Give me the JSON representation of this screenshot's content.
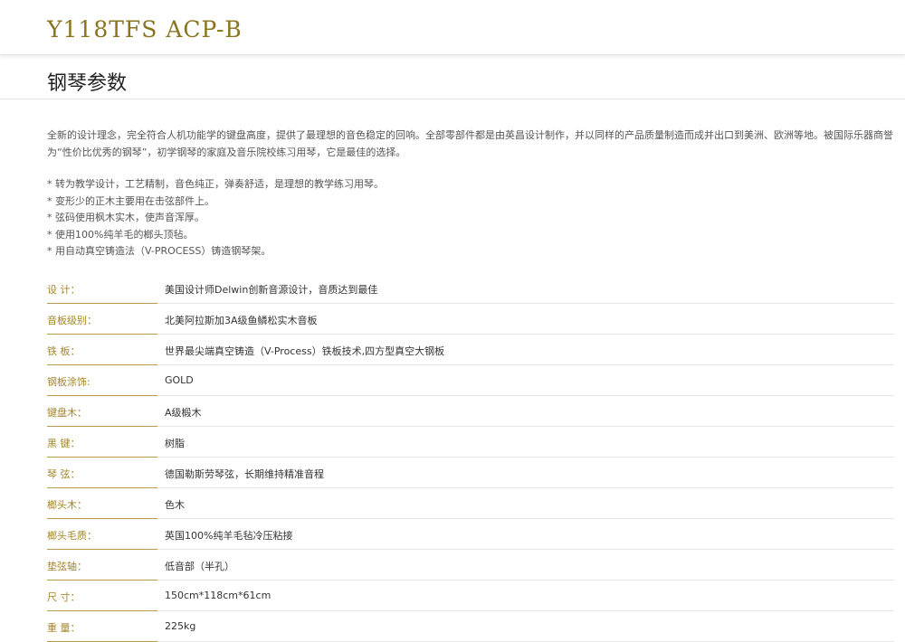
{
  "header": {
    "model": "Y118TFS ACP-B"
  },
  "section": {
    "title": "钢琴参数"
  },
  "intro": {
    "paragraph": "全新的设计理念，完全符合人机功能学的键盘高度，提供了最理想的音色稳定的回响。全部零部件都是由英昌设计制作，并以同样的产品质量制造而成并出口到美洲、欧洲等地。被国际乐器商誉为“性价比优秀的钢琴”，初学钢琴的家庭及音乐院校练习用琴，它是最佳的选择。"
  },
  "features": [
    "转为教学设计，工艺精制，音色纯正，弹奏舒适，是理想的教学练习用琴。",
    "变形少的正木主要用在击弦部件上。",
    "弦码使用枫木实木，使声音浑厚。",
    "使用100%纯羊毛的榔头顶毡。",
    "用自动真空铸造法（V-PROCESS）铸造钢琴架。"
  ],
  "specs": [
    {
      "label": "设 计：",
      "value": "美国设计师Delwin创新音源设计，音质达到最佳"
    },
    {
      "label": "音板级别：",
      "value": "北美阿拉斯加3A级鱼鳞松实木音板"
    },
    {
      "label": "铁 板：",
      "value": "世界最尖端真空铸造（V-Process）铁板技术,四方型真空大钢板"
    },
    {
      "label": "钢板涂饰:",
      "value": "GOLD"
    },
    {
      "label": "键盘木：",
      "value": "A级椴木"
    },
    {
      "label": "黑 键：",
      "value": "树脂"
    },
    {
      "label": "琴 弦：",
      "value": "德国勒斯劳琴弦，长期维持精准音程"
    },
    {
      "label": "榔头木：",
      "value": "色木"
    },
    {
      "label": "榔头毛质：",
      "value": "英国100%纯羊毛毡冷压粘接"
    },
    {
      "label": "垫弦轴：",
      "value": "低音部（半孔）"
    },
    {
      "label": "尺 寸：",
      "value": "150cm*118cm*61cm"
    },
    {
      "label": "重 量：",
      "value": "225kg"
    }
  ]
}
